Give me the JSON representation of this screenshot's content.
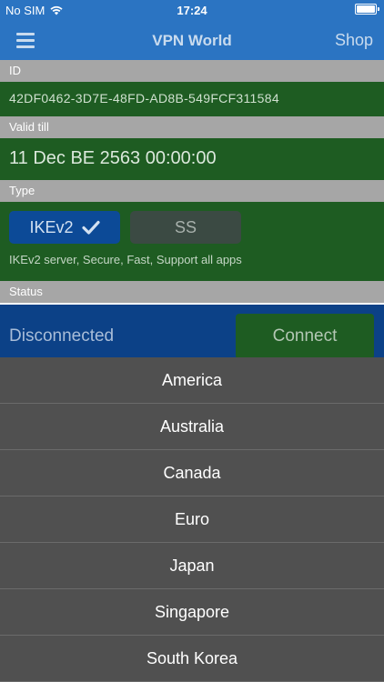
{
  "status_bar": {
    "carrier": "No SIM",
    "time": "17:24"
  },
  "nav": {
    "title": "VPN World",
    "shop_label": "Shop"
  },
  "id_section": {
    "header": "ID",
    "value": "42DF0462-3D7E-48FD-AD8B-549FCF311584"
  },
  "valid_section": {
    "header": "Valid till",
    "value": "11 Dec BE 2563 00:00:00"
  },
  "type_section": {
    "header": "Type",
    "ikev2_label": "IKEv2",
    "ss_label": "SS",
    "description": "IKEv2 server, Secure, Fast, Support all apps"
  },
  "status_section": {
    "header": "Status",
    "value": "Disconnected",
    "connect_label": "Connect"
  },
  "regions": [
    "America",
    "Australia",
    "Canada",
    "Euro",
    "Japan",
    "Singapore",
    "South Korea"
  ]
}
